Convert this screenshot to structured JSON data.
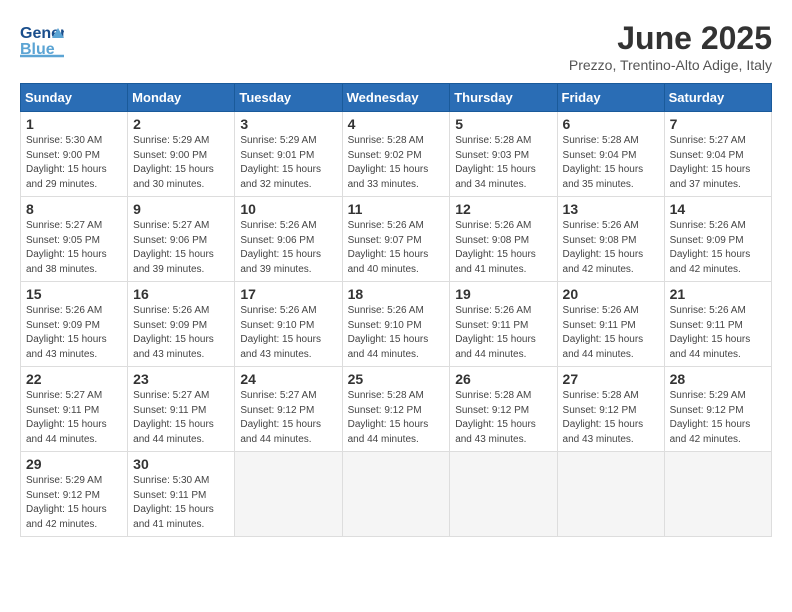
{
  "header": {
    "logo_general": "General",
    "logo_blue": "Blue",
    "month": "June 2025",
    "location": "Prezzo, Trentino-Alto Adige, Italy"
  },
  "weekdays": [
    "Sunday",
    "Monday",
    "Tuesday",
    "Wednesday",
    "Thursday",
    "Friday",
    "Saturday"
  ],
  "days": [
    {
      "num": "",
      "info": ""
    },
    {
      "num": "",
      "info": ""
    },
    {
      "num": "",
      "info": ""
    },
    {
      "num": "",
      "info": ""
    },
    {
      "num": "",
      "info": ""
    },
    {
      "num": "",
      "info": ""
    },
    {
      "num": "",
      "info": ""
    },
    {
      "num": "1",
      "info": "Sunrise: 5:30 AM\nSunset: 9:00 PM\nDaylight: 15 hours\nand 29 minutes."
    },
    {
      "num": "2",
      "info": "Sunrise: 5:29 AM\nSunset: 9:00 PM\nDaylight: 15 hours\nand 30 minutes."
    },
    {
      "num": "3",
      "info": "Sunrise: 5:29 AM\nSunset: 9:01 PM\nDaylight: 15 hours\nand 32 minutes."
    },
    {
      "num": "4",
      "info": "Sunrise: 5:28 AM\nSunset: 9:02 PM\nDaylight: 15 hours\nand 33 minutes."
    },
    {
      "num": "5",
      "info": "Sunrise: 5:28 AM\nSunset: 9:03 PM\nDaylight: 15 hours\nand 34 minutes."
    },
    {
      "num": "6",
      "info": "Sunrise: 5:28 AM\nSunset: 9:04 PM\nDaylight: 15 hours\nand 35 minutes."
    },
    {
      "num": "7",
      "info": "Sunrise: 5:27 AM\nSunset: 9:04 PM\nDaylight: 15 hours\nand 37 minutes."
    },
    {
      "num": "8",
      "info": "Sunrise: 5:27 AM\nSunset: 9:05 PM\nDaylight: 15 hours\nand 38 minutes."
    },
    {
      "num": "9",
      "info": "Sunrise: 5:27 AM\nSunset: 9:06 PM\nDaylight: 15 hours\nand 39 minutes."
    },
    {
      "num": "10",
      "info": "Sunrise: 5:26 AM\nSunset: 9:06 PM\nDaylight: 15 hours\nand 39 minutes."
    },
    {
      "num": "11",
      "info": "Sunrise: 5:26 AM\nSunset: 9:07 PM\nDaylight: 15 hours\nand 40 minutes."
    },
    {
      "num": "12",
      "info": "Sunrise: 5:26 AM\nSunset: 9:08 PM\nDaylight: 15 hours\nand 41 minutes."
    },
    {
      "num": "13",
      "info": "Sunrise: 5:26 AM\nSunset: 9:08 PM\nDaylight: 15 hours\nand 42 minutes."
    },
    {
      "num": "14",
      "info": "Sunrise: 5:26 AM\nSunset: 9:09 PM\nDaylight: 15 hours\nand 42 minutes."
    },
    {
      "num": "15",
      "info": "Sunrise: 5:26 AM\nSunset: 9:09 PM\nDaylight: 15 hours\nand 43 minutes."
    },
    {
      "num": "16",
      "info": "Sunrise: 5:26 AM\nSunset: 9:09 PM\nDaylight: 15 hours\nand 43 minutes."
    },
    {
      "num": "17",
      "info": "Sunrise: 5:26 AM\nSunset: 9:10 PM\nDaylight: 15 hours\nand 43 minutes."
    },
    {
      "num": "18",
      "info": "Sunrise: 5:26 AM\nSunset: 9:10 PM\nDaylight: 15 hours\nand 44 minutes."
    },
    {
      "num": "19",
      "info": "Sunrise: 5:26 AM\nSunset: 9:11 PM\nDaylight: 15 hours\nand 44 minutes."
    },
    {
      "num": "20",
      "info": "Sunrise: 5:26 AM\nSunset: 9:11 PM\nDaylight: 15 hours\nand 44 minutes."
    },
    {
      "num": "21",
      "info": "Sunrise: 5:26 AM\nSunset: 9:11 PM\nDaylight: 15 hours\nand 44 minutes."
    },
    {
      "num": "22",
      "info": "Sunrise: 5:27 AM\nSunset: 9:11 PM\nDaylight: 15 hours\nand 44 minutes."
    },
    {
      "num": "23",
      "info": "Sunrise: 5:27 AM\nSunset: 9:11 PM\nDaylight: 15 hours\nand 44 minutes."
    },
    {
      "num": "24",
      "info": "Sunrise: 5:27 AM\nSunset: 9:12 PM\nDaylight: 15 hours\nand 44 minutes."
    },
    {
      "num": "25",
      "info": "Sunrise: 5:28 AM\nSunset: 9:12 PM\nDaylight: 15 hours\nand 44 minutes."
    },
    {
      "num": "26",
      "info": "Sunrise: 5:28 AM\nSunset: 9:12 PM\nDaylight: 15 hours\nand 43 minutes."
    },
    {
      "num": "27",
      "info": "Sunrise: 5:28 AM\nSunset: 9:12 PM\nDaylight: 15 hours\nand 43 minutes."
    },
    {
      "num": "28",
      "info": "Sunrise: 5:29 AM\nSunset: 9:12 PM\nDaylight: 15 hours\nand 42 minutes."
    },
    {
      "num": "29",
      "info": "Sunrise: 5:29 AM\nSunset: 9:12 PM\nDaylight: 15 hours\nand 42 minutes."
    },
    {
      "num": "30",
      "info": "Sunrise: 5:30 AM\nSunset: 9:11 PM\nDaylight: 15 hours\nand 41 minutes."
    },
    {
      "num": "",
      "info": ""
    },
    {
      "num": "",
      "info": ""
    },
    {
      "num": "",
      "info": ""
    },
    {
      "num": "",
      "info": ""
    },
    {
      "num": "",
      "info": ""
    }
  ]
}
